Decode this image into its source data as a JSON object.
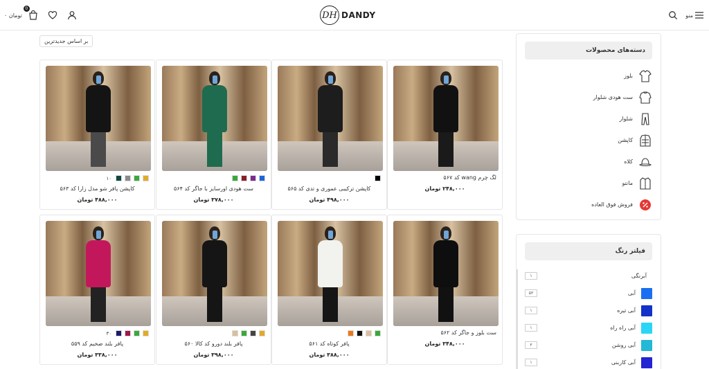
{
  "header": {
    "cart_total": "۰ تومان",
    "cart_count": "0",
    "logo_text": "DANDY",
    "logo_mark": "DH",
    "menu_label": "منو"
  },
  "sort": {
    "label": "بر اساس جدیدترین"
  },
  "products": [
    {
      "name": "لگ چرم wang کد ۵۶۷",
      "price": "۲۴۸,۰۰۰ تومان",
      "swatches": [],
      "count": "",
      "torso": "#111111",
      "legs": "#1a1a1a"
    },
    {
      "name": "کاپشن ترکیبی عموری و تدی کد ۵۶۵",
      "price": "۴۹۸,۰۰۰ تومان",
      "swatches": [
        "#000000"
      ],
      "count": "",
      "torso": "#1d1d1d",
      "legs": "#2a2a2a"
    },
    {
      "name": "ست هودی اورسایز با جاگر کد ۵۶۴",
      "price": "۳۷۸,۰۰۰ تومان",
      "swatches": [
        "#1e64d8",
        "#7a2a8f",
        "#8a1e2a",
        "#3aa83a"
      ],
      "count": "",
      "torso": "#1f6b4f",
      "legs": "#1f6b4f"
    },
    {
      "name": "کاپشن پافر شو مدل زارا کد ۵۶۳",
      "price": "۴۸۸,۰۰۰ تومان",
      "swatches": [
        "#e3a92a",
        "#3aa83a",
        "#8a8a8a",
        "#0c4a3f"
      ],
      "count": "۱۰",
      "torso": "#141414",
      "legs": "#4a4a4a"
    },
    {
      "name": "ست بلوز و جاگر کد ۵۶۲",
      "price": "۳۴۸,۰۰۰ تومان",
      "swatches": [],
      "count": "",
      "torso": "#0e0e0e",
      "legs": "#111111"
    },
    {
      "name": "پافر کوتاه کد ۵۶۱",
      "price": "۳۸۸,۰۰۰ تومان",
      "swatches": [
        "#3aa83a",
        "#d9c09a",
        "#111111",
        "#e87a1c"
      ],
      "count": "",
      "torso": "#f2f2ee",
      "legs": "#161616"
    },
    {
      "name": "پافر بلند دورو کد کالا ۵۶۰",
      "price": "۳۹۸,۰۰۰ تومان",
      "swatches": [
        "#e3a92a",
        "#444444",
        "#3aa83a",
        "#d9c09a"
      ],
      "count": "",
      "torso": "#151515",
      "legs": "#151515"
    },
    {
      "name": "پافر بلند ضخیم کد ۵۵۹",
      "price": "۳۳۸,۰۰۰ تومان",
      "swatches": [
        "#e3a92a",
        "#3aa83a",
        "#a0174a",
        "#1b1b6b"
      ],
      "count": "۳۰",
      "torso": "#c2185b",
      "legs": "#222222"
    }
  ],
  "categories": {
    "title": "دسته‌های محصولات",
    "items": [
      {
        "label": "بلوز",
        "icon": "shirt-icon"
      },
      {
        "label": "ست هودی شلوار",
        "icon": "hoodie-set-icon"
      },
      {
        "label": "شلوار",
        "icon": "pants-icon"
      },
      {
        "label": "کاپشن",
        "icon": "jacket-icon"
      },
      {
        "label": "کلاه",
        "icon": "hat-icon"
      },
      {
        "label": "مانتو",
        "icon": "coat-icon"
      },
      {
        "label": "فروش فوق العاده",
        "icon": "sale-percent-icon"
      }
    ]
  },
  "color_filter": {
    "title": "فیلتر رنگ",
    "items": [
      {
        "label": "آبرنگی",
        "color": "",
        "count": "۱"
      },
      {
        "label": "آبی",
        "color": "#1a6ff0",
        "count": "۵۳"
      },
      {
        "label": "آبی تیره",
        "color": "#1232c8",
        "count": "۱"
      },
      {
        "label": "آبی راه راه",
        "color": "#2ad6f5",
        "count": "۱"
      },
      {
        "label": "آبی روشن",
        "color": "#22b8d6",
        "count": "۳"
      },
      {
        "label": "آبی کاربنی",
        "color": "#2424d0",
        "count": "۱"
      }
    ]
  }
}
